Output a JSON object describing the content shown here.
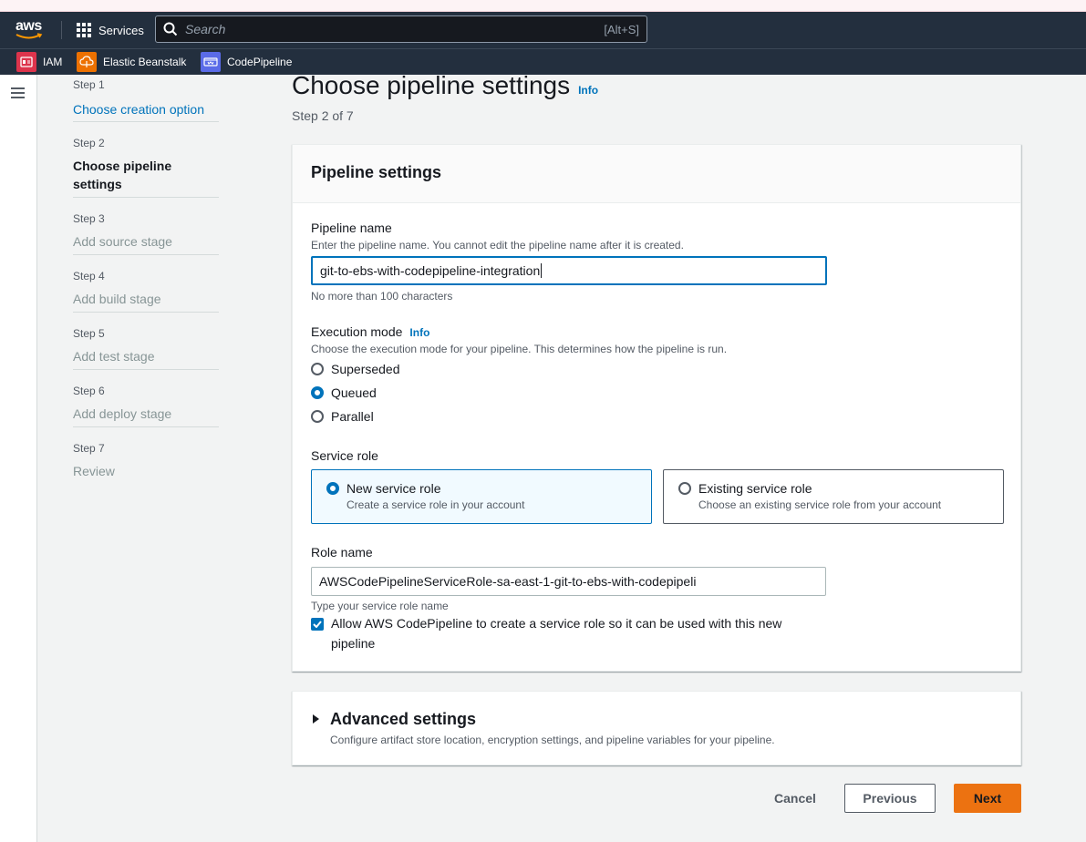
{
  "nav": {
    "logo": "aws",
    "services_label": "Services",
    "search_placeholder": "Search",
    "search_shortcut": "[Alt+S]",
    "favorites": [
      {
        "label": "IAM",
        "icon": "iam-icon",
        "color": "#dd344c"
      },
      {
        "label": "Elastic Beanstalk",
        "icon": "elastic-beanstalk-icon",
        "color": "#ed7100"
      },
      {
        "label": "CodePipeline",
        "icon": "codepipeline-icon",
        "color": "#5a6be8"
      }
    ]
  },
  "steps": [
    {
      "num": "Step 1",
      "label": "Choose creation option",
      "state": "link"
    },
    {
      "num": "Step 2",
      "label": "Choose pipeline settings",
      "state": "current"
    },
    {
      "num": "Step 3",
      "label": "Add source stage",
      "state": "disabled"
    },
    {
      "num": "Step 4",
      "label": "Add build stage",
      "state": "disabled"
    },
    {
      "num": "Step 5",
      "label": "Add test stage",
      "state": "disabled"
    },
    {
      "num": "Step 6",
      "label": "Add deploy stage",
      "state": "disabled"
    },
    {
      "num": "Step 7",
      "label": "Review",
      "state": "disabled"
    }
  ],
  "page": {
    "title": "Choose pipeline settings",
    "info": "Info",
    "subtitle": "Step 2 of 7"
  },
  "settings": {
    "header": "Pipeline settings",
    "pipeline_name_label": "Pipeline name",
    "pipeline_name_desc": "Enter the pipeline name. You cannot edit the pipeline name after it is created.",
    "pipeline_name_value": "git-to-ebs-with-codepipeline-integration",
    "pipeline_name_hint": "No more than 100 characters",
    "exec_mode_label": "Execution mode",
    "exec_mode_info": "Info",
    "exec_mode_desc": "Choose the execution mode for your pipeline. This determines how the pipeline is run.",
    "exec_modes": [
      {
        "label": "Superseded",
        "selected": false
      },
      {
        "label": "Queued",
        "selected": true
      },
      {
        "label": "Parallel",
        "selected": false
      }
    ],
    "service_role_label": "Service role",
    "roles": [
      {
        "title": "New service role",
        "desc": "Create a service role in your account",
        "selected": true
      },
      {
        "title": "Existing service role",
        "desc": "Choose an existing service role from your account",
        "selected": false
      }
    ],
    "role_name_label": "Role name",
    "role_name_value": "AWSCodePipelineServiceRole-sa-east-1-git-to-ebs-with-codepipeli",
    "role_name_hint": "Type your service role name",
    "allow_checkbox_label": "Allow AWS CodePipeline to create a service role so it can be used with this new pipeline",
    "allow_checked": true
  },
  "advanced": {
    "title": "Advanced settings",
    "desc": "Configure artifact store location, encryption settings, and pipeline variables for your pipeline."
  },
  "actions": {
    "cancel": "Cancel",
    "previous": "Previous",
    "next": "Next"
  },
  "colors": {
    "primary": "#ec7211",
    "link": "#0073bb",
    "header_bg": "#232f3e"
  }
}
